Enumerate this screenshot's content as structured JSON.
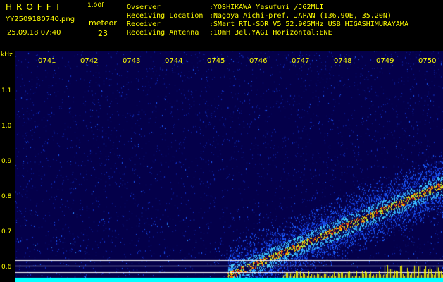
{
  "header": {
    "app_name": "HROFFT",
    "version": "1.00f",
    "filename": "YY2509180740.png",
    "mode": "meteor",
    "datetime": "25.09.18 07:40",
    "count": "23",
    "info": [
      {
        "key": "Ovserver",
        "value": ":YOSHIKAWA Yasufumi /JG2MLI"
      },
      {
        "key": "Receiving Location",
        "value": ":Nagoya Aichi-pref. JAPAN (136.90E, 35.20N)"
      },
      {
        "key": "Receiver",
        "value": ":SMart RTL-SDR V5 52.905MHz USB HIGASHIMURAYAMA"
      },
      {
        "key": "Receiving Antenna",
        "value": ":10mH 3el.YAGI Horizontal:ENE"
      }
    ]
  },
  "spectrogram": {
    "y_unit": "kHz",
    "y_ticks": [
      "1.1",
      "1.0",
      "0.9",
      "0.8",
      "0.7",
      "0.6"
    ],
    "x_ticks": [
      "0741",
      "0742",
      "0743",
      "0744",
      "0745",
      "0746",
      "0747",
      "0748",
      "0749",
      "0750"
    ],
    "colors": {
      "background": "#04004a",
      "label": "#ffff00",
      "hline": "#ffffff",
      "bottom_band": "#00ffff"
    }
  }
}
